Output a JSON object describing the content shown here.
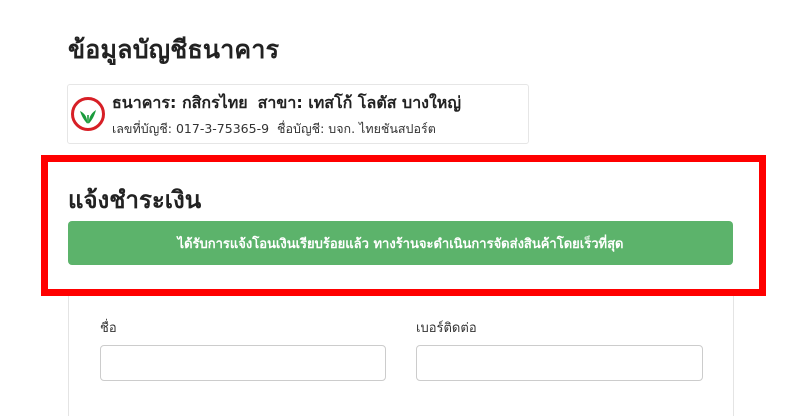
{
  "page": {
    "title": "ข้อมูลบัญชีธนาคาร"
  },
  "bank": {
    "bank_label": "ธนาคาร: กสิกรไทย",
    "branch_label": "สาขา: เทสโก้ โลตัส บางใหญ่",
    "account_number": "เลขที่บัญชี: 017-3-75365-9",
    "account_name": "ชื่อบัญชี: บจก. ไทยชันสปอร์ต",
    "logo_icon": "kasikorn-bank-logo-icon",
    "logo_color": "#d71f26",
    "logo_leaf_color": "#1a9b3c"
  },
  "payment": {
    "heading": "แจ้งชำระเงิน",
    "success_message": "ได้รับการแจ้งโอนเงินเรียบร้อยแล้ว ทางร้านจะดำเนินการจัดส่งสินค้าโดยเร็วที่สุด",
    "success_color": "#5cb36b",
    "highlight_color": "#ff0000"
  },
  "form": {
    "name_label": "ชื่อ",
    "name_value": "",
    "phone_label": "เบอร์ติดต่อ",
    "phone_value": ""
  }
}
